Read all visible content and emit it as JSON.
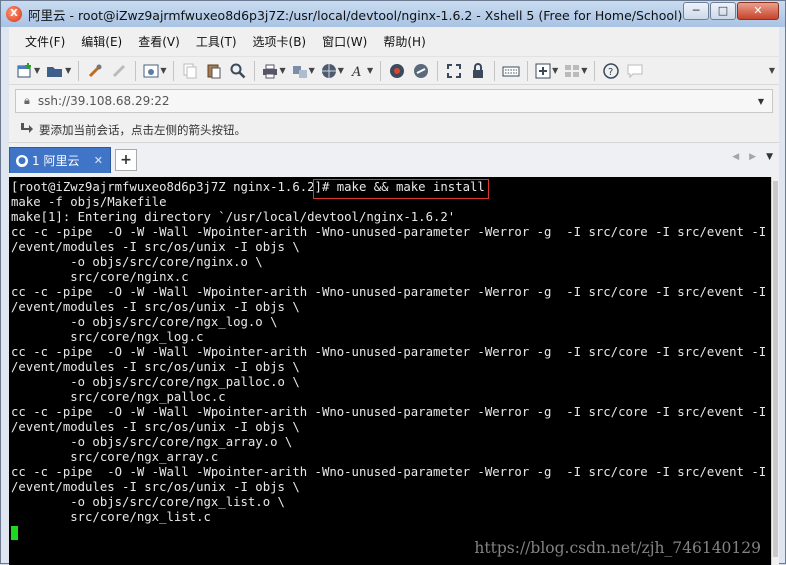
{
  "window": {
    "title": "阿里云 - root@iZwz9ajrmfwuxeo8d6p3j7Z:/usr/local/devtool/nginx-1.6.2 - Xshell 5 (Free for Home/School)",
    "app_icon": "xshell-icon",
    "minimize_glyph": "─",
    "maximize_glyph": "□",
    "close_glyph": "✕"
  },
  "menu": [
    "文件(F)",
    "编辑(E)",
    "查看(V)",
    "工具(T)",
    "选项卡(B)",
    "窗口(W)",
    "帮助(H)"
  ],
  "toolbar_icons": [
    "new-session-icon",
    "open-folder-icon",
    "connect-icon",
    "disconnect-icon",
    "properties-icon",
    "copy-icon",
    "paste-icon",
    "find-icon",
    "print-icon",
    "transfer-icon",
    "globe-icon",
    "font-icon",
    "xftp-icon",
    "script-icon",
    "fullscreen-icon",
    "lock-icon",
    "keyboard-icon",
    "add-icon",
    "layout-icon",
    "help-icon",
    "chat-icon"
  ],
  "address": {
    "value": "ssh://39.108.68.29:22"
  },
  "hint": {
    "text": "要添加当前会话，点击左侧的箭头按钮。"
  },
  "tabs": [
    {
      "label": "1 阿里云",
      "active": true
    }
  ],
  "tab_add_label": "+",
  "terminal": {
    "background": "#000000",
    "foreground": "#e8e8e8",
    "cursor_color": "#1ed81e",
    "lines": [
      "[root@iZwz9ajrmfwuxeo8d6p3j7Z nginx-1.6.2]# make && make install",
      "make -f objs/Makefile",
      "make[1]: Entering directory `/usr/local/devtool/nginx-1.6.2'",
      "cc -c -pipe  -O -W -Wall -Wpointer-arith -Wno-unused-parameter -Werror -g  -I src/core -I src/event -I src",
      "/event/modules -I src/os/unix -I objs \\",
      "        -o objs/src/core/nginx.o \\",
      "        src/core/nginx.c",
      "cc -c -pipe  -O -W -Wall -Wpointer-arith -Wno-unused-parameter -Werror -g  -I src/core -I src/event -I src",
      "/event/modules -I src/os/unix -I objs \\",
      "        -o objs/src/core/ngx_log.o \\",
      "        src/core/ngx_log.c",
      "cc -c -pipe  -O -W -Wall -Wpointer-arith -Wno-unused-parameter -Werror -g  -I src/core -I src/event -I src",
      "/event/modules -I src/os/unix -I objs \\",
      "        -o objs/src/core/ngx_palloc.o \\",
      "        src/core/ngx_palloc.c",
      "cc -c -pipe  -O -W -Wall -Wpointer-arith -Wno-unused-parameter -Werror -g  -I src/core -I src/event -I src",
      "/event/modules -I src/os/unix -I objs \\",
      "        -o objs/src/core/ngx_array.o \\",
      "        src/core/ngx_array.c",
      "cc -c -pipe  -O -W -Wall -Wpointer-arith -Wno-unused-parameter -Werror -g  -I src/core -I src/event -I src",
      "/event/modules -I src/os/unix -I objs \\",
      "        -o objs/src/core/ngx_list.o \\",
      "        src/core/ngx_list.c"
    ],
    "highlighted_command": "make && make install"
  },
  "watermark": "https://blog.csdn.net/zjh_746140129"
}
